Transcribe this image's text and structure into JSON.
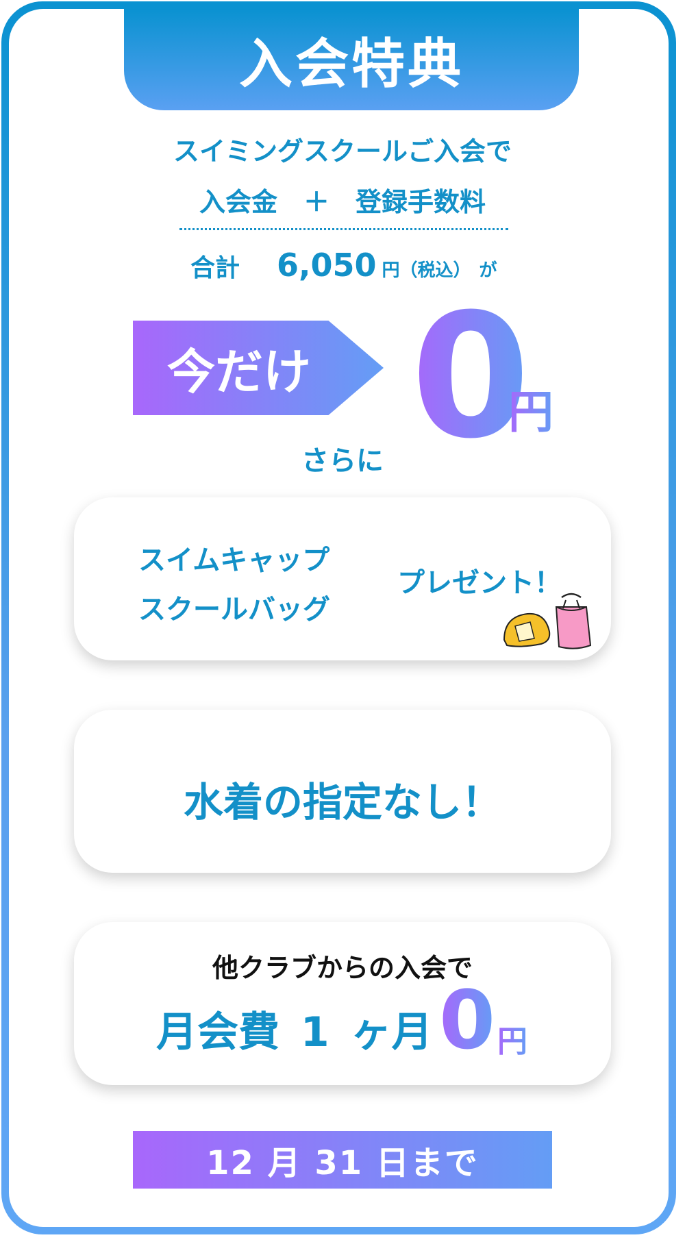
{
  "title": "入会特典",
  "intro": {
    "line1": "スイミングスクールご入会で",
    "line2": "入会金　＋　登録手数料",
    "total_label": "合計",
    "total_amount": "6,050",
    "total_unit": "円（税込）",
    "total_particle": "が"
  },
  "offer": {
    "badge": "今だけ",
    "price": "0",
    "yen": "円"
  },
  "sarani": "さらに",
  "present_card": {
    "item1": "スイムキャップ",
    "item2": "スクールバッグ",
    "action": "プレゼント！",
    "illustration": "swim-cap-and-bag-icon"
  },
  "swimsuit_card": {
    "text": "水着の指定なし！"
  },
  "transfer_card": {
    "top": "他クラブからの入会で",
    "main": "月会費 1 ヶ月",
    "price": "0",
    "yen": "円"
  },
  "deadline": "12 月 31 日まで",
  "colors": {
    "brand_blue": "#1390c8",
    "gradient_start": "#a867fb",
    "gradient_end": "#649df5"
  }
}
